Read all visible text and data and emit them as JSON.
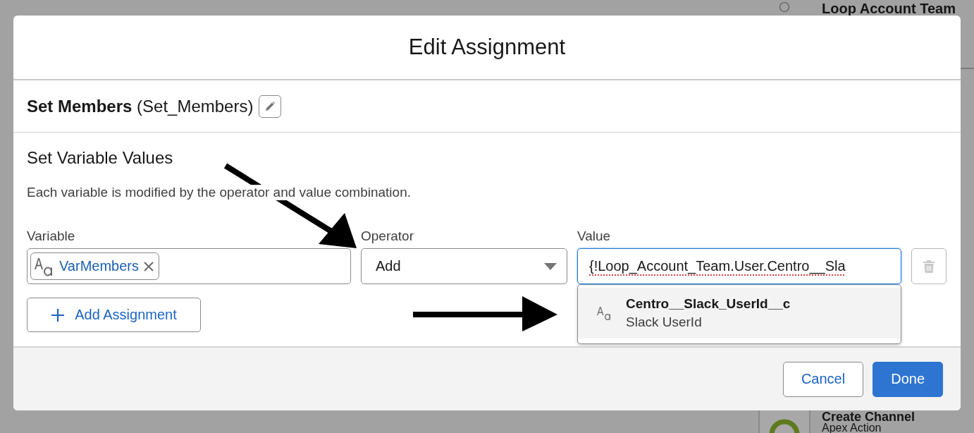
{
  "background": {
    "items": [
      {
        "title": "Loop Account Team",
        "kind": "loop"
      },
      {
        "title": "Create Channel",
        "subtitle": "Apex Action",
        "kind": "action"
      }
    ]
  },
  "modal": {
    "title": "Edit Assignment",
    "element": {
      "label": "Set Members",
      "api_name": "(Set_Members)"
    },
    "section_title": "Set Variable Values",
    "description": "Each variable is modified by the operator and value combination.",
    "assignment": {
      "variable": {
        "label": "Variable",
        "pill": "VarMembers"
      },
      "operator": {
        "label": "Operator",
        "value": "Add"
      },
      "value": {
        "label": "Value",
        "value": "{!Loop_Account_Team.User.Centro__Sla",
        "focused": true
      }
    },
    "suggestions": [
      {
        "title": "Centro__Slack_UserId__c",
        "subtitle": "Slack UserId",
        "selected": true
      }
    ],
    "add_button": "Add Assignment",
    "footer_buttons": [
      {
        "label": "Cancel",
        "kind": "neutral"
      },
      {
        "label": "Done",
        "kind": "brand"
      }
    ]
  }
}
